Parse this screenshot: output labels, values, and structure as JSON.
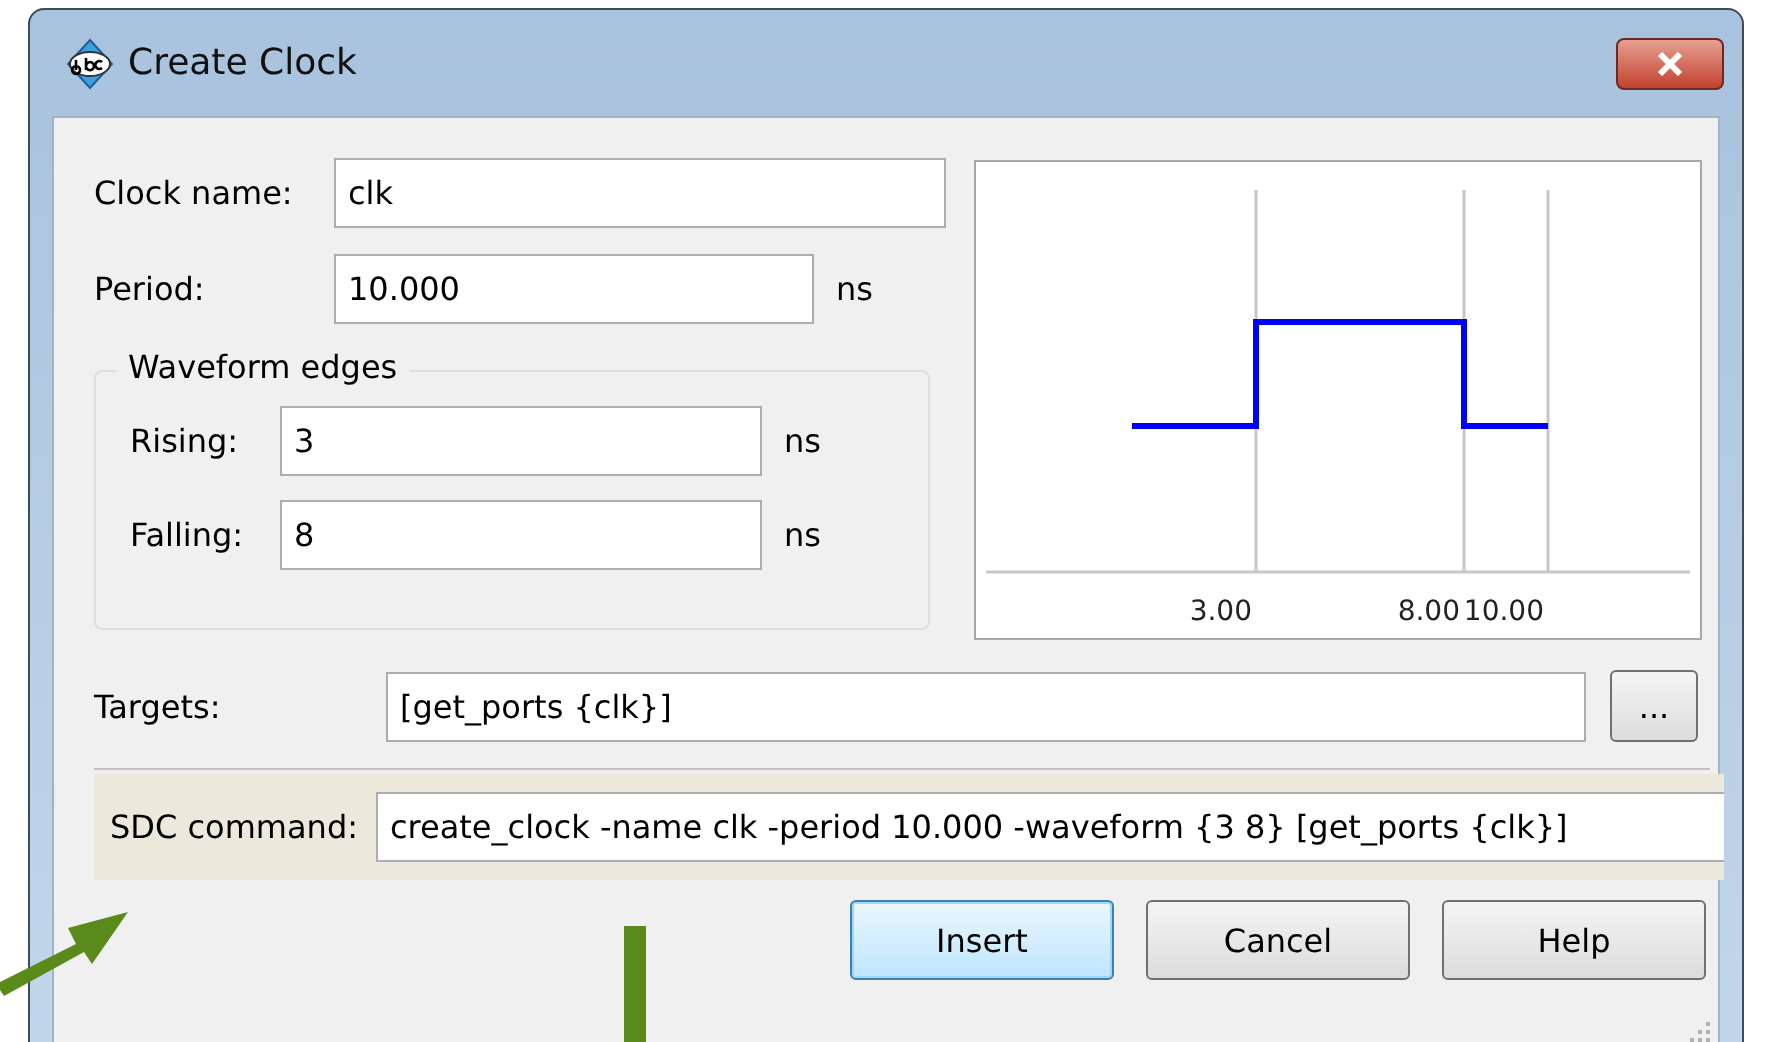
{
  "window": {
    "title": "Create Clock"
  },
  "clock_name": {
    "label": "Clock name:",
    "value": "clk"
  },
  "period": {
    "label": "Period:",
    "value": "10.000",
    "unit": "ns"
  },
  "waveform_edges": {
    "title": "Waveform edges",
    "fields": [
      {
        "label": "Rising:",
        "value": "3",
        "unit": "ns"
      },
      {
        "label": "Falling:",
        "value": "8",
        "unit": "ns"
      }
    ]
  },
  "preview": {
    "tick_labels": [
      "3.00",
      "8.00",
      "10.00"
    ]
  },
  "targets": {
    "label": "Targets:",
    "value": "[get_ports {clk}]",
    "browse_button": "..."
  },
  "sdc_command": {
    "label": "SDC command:",
    "value": "create_clock -name clk -period 10.000 -waveform {3 8} [get_ports {clk}]"
  },
  "buttons": [
    {
      "label": "Insert",
      "default": true
    },
    {
      "label": "Cancel",
      "default": false
    },
    {
      "label": "Help",
      "default": false
    }
  ]
}
